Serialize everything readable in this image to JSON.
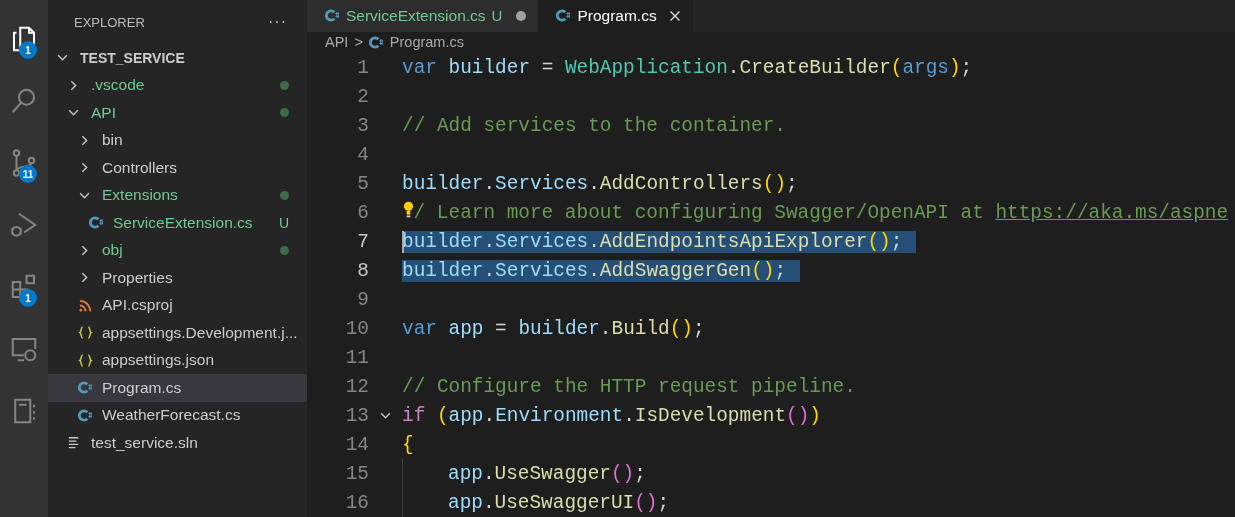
{
  "activity_bar": [
    {
      "kind": "files",
      "selected": true,
      "badge": "1"
    },
    {
      "kind": "search",
      "selected": false
    },
    {
      "kind": "source-control",
      "selected": false,
      "badge": "11"
    },
    {
      "kind": "run-debug",
      "selected": false
    },
    {
      "kind": "extensions",
      "selected": false,
      "badge": "1"
    },
    {
      "kind": "remote",
      "selected": false
    },
    {
      "kind": "notebook",
      "selected": false
    }
  ],
  "explorer": {
    "title": "EXPLORER",
    "more": "···",
    "tree": [
      {
        "label": "TEST_SERVICE",
        "kind": "root",
        "expanded": true,
        "selected": false,
        "children": [
          {
            "label": ".vscode",
            "kind": "folder",
            "expanded": false,
            "selected": false,
            "changed": true
          },
          {
            "label": "API",
            "kind": "folder",
            "expanded": true,
            "selected": false,
            "changed": true,
            "children": [
              {
                "label": "bin",
                "kind": "folder",
                "expanded": false,
                "selected": false
              },
              {
                "label": "Controllers",
                "kind": "folder",
                "expanded": false,
                "selected": false
              },
              {
                "label": "Extensions",
                "kind": "folder",
                "expanded": true,
                "selected": false,
                "changed": true,
                "children": [
                  {
                    "label": "ServiceExtension.cs",
                    "kind": "cs",
                    "selected": false,
                    "changed": true,
                    "decoration": "U"
                  }
                ]
              },
              {
                "label": "obj",
                "kind": "folder",
                "expanded": false,
                "selected": false,
                "changed": true
              },
              {
                "label": "Properties",
                "kind": "folder",
                "expanded": false,
                "selected": false
              },
              {
                "label": "API.csproj",
                "kind": "csproj",
                "selected": false
              },
              {
                "label": "appsettings.Development.j...",
                "kind": "json",
                "selected": false
              },
              {
                "label": "appsettings.json",
                "kind": "json",
                "selected": false
              },
              {
                "label": "Program.cs",
                "kind": "cs",
                "selected": true
              },
              {
                "label": "WeatherForecast.cs",
                "kind": "cs",
                "selected": false
              }
            ]
          },
          {
            "label": "test_service.sln",
            "kind": "sln",
            "selected": false
          }
        ]
      }
    ]
  },
  "tabs": [
    {
      "label": "ServiceExtension.cs",
      "selected": false,
      "changed": true,
      "decoration": "U",
      "dirty": true
    },
    {
      "label": "Program.cs",
      "selected": true,
      "dirty": false
    }
  ],
  "breadcrumb": {
    "folder": "API",
    "separator": ">",
    "file": "Program.cs"
  },
  "lines": [
    {
      "number": "1",
      "selected": false,
      "tokens": [
        {
          "kind": "keyword",
          "text": "var"
        },
        {
          "kind": "variable",
          "text": " builder"
        },
        {
          "kind": "plain",
          "text": " = "
        },
        {
          "kind": "type",
          "text": "WebApplication"
        },
        {
          "kind": "plain",
          "text": "."
        },
        {
          "kind": "method",
          "text": "CreateBuilder"
        },
        {
          "kind": "paren1",
          "text": "("
        },
        {
          "kind": "param",
          "text": "args"
        },
        {
          "kind": "paren1",
          "text": ")"
        },
        {
          "kind": "plain",
          "text": ";"
        }
      ]
    },
    {
      "number": "2",
      "selected": false
    },
    {
      "number": "3",
      "selected": false,
      "tokens": [
        {
          "kind": "comment",
          "text": "// Add services to the container."
        }
      ]
    },
    {
      "number": "4",
      "selected": false
    },
    {
      "number": "5",
      "selected": false,
      "tokens": [
        {
          "kind": "variable",
          "text": "builder"
        },
        {
          "kind": "plain",
          "text": "."
        },
        {
          "kind": "variable",
          "text": "Services"
        },
        {
          "kind": "plain",
          "text": "."
        },
        {
          "kind": "method",
          "text": "AddControllers"
        },
        {
          "kind": "paren1",
          "text": "()"
        },
        {
          "kind": "plain",
          "text": ";"
        }
      ]
    },
    {
      "number": "6",
      "selected": false,
      "lightbulb": true,
      "tokens": [
        {
          "kind": "comment",
          "text": "/ Learn more about configuring Swagger/OpenAPI at "
        },
        {
          "kind": "link",
          "text": "https://aka.ms/aspne"
        }
      ]
    },
    {
      "number": "7",
      "selected": true,
      "cursor": true,
      "tokens": [
        {
          "kind": "variable",
          "text": "builder"
        },
        {
          "kind": "plain",
          "text": "."
        },
        {
          "kind": "variable",
          "text": "Services"
        },
        {
          "kind": "plain",
          "text": "."
        },
        {
          "kind": "method",
          "text": "AddEndpointsApiExplorer"
        },
        {
          "kind": "paren1",
          "text": "()"
        },
        {
          "kind": "plain",
          "text": ";"
        }
      ]
    },
    {
      "number": "8",
      "selected": true,
      "tokens": [
        {
          "kind": "variable",
          "text": "builder"
        },
        {
          "kind": "plain",
          "text": "."
        },
        {
          "kind": "variable",
          "text": "Services"
        },
        {
          "kind": "plain",
          "text": "."
        },
        {
          "kind": "method",
          "text": "AddSwaggerGen"
        },
        {
          "kind": "paren1",
          "text": "()"
        },
        {
          "kind": "plain",
          "text": ";"
        }
      ]
    },
    {
      "number": "9",
      "selected": false
    },
    {
      "number": "10",
      "selected": false,
      "tokens": [
        {
          "kind": "keyword",
          "text": "var"
        },
        {
          "kind": "variable",
          "text": " app"
        },
        {
          "kind": "plain",
          "text": " = "
        },
        {
          "kind": "variable",
          "text": "builder"
        },
        {
          "kind": "plain",
          "text": "."
        },
        {
          "kind": "method",
          "text": "Build"
        },
        {
          "kind": "paren1",
          "text": "()"
        },
        {
          "kind": "plain",
          "text": ";"
        }
      ]
    },
    {
      "number": "11",
      "selected": false
    },
    {
      "number": "12",
      "selected": false,
      "tokens": [
        {
          "kind": "comment",
          "text": "// Configure the HTTP request pipeline."
        }
      ]
    },
    {
      "number": "13",
      "selected": false,
      "fold": true,
      "tokens": [
        {
          "kind": "control",
          "text": "if"
        },
        {
          "kind": "paren1",
          "text": " ("
        },
        {
          "kind": "variable",
          "text": "app"
        },
        {
          "kind": "plain",
          "text": "."
        },
        {
          "kind": "variable",
          "text": "Environment"
        },
        {
          "kind": "plain",
          "text": "."
        },
        {
          "kind": "method",
          "text": "IsDevelopment"
        },
        {
          "kind": "paren2",
          "text": "()"
        },
        {
          "kind": "paren1",
          "text": ")"
        }
      ]
    },
    {
      "number": "14",
      "selected": false,
      "tokens": [
        {
          "kind": "paren1",
          "text": "{"
        }
      ]
    },
    {
      "number": "15",
      "selected": false,
      "indent": true,
      "tokens": [
        {
          "kind": "variable",
          "text": "app"
        },
        {
          "kind": "plain",
          "text": "."
        },
        {
          "kind": "method",
          "text": "UseSwagger"
        },
        {
          "kind": "paren2",
          "text": "()"
        },
        {
          "kind": "plain",
          "text": ";"
        }
      ]
    },
    {
      "number": "16",
      "selected": false,
      "indent": true,
      "tokens": [
        {
          "kind": "variable",
          "text": "app"
        },
        {
          "kind": "plain",
          "text": "."
        },
        {
          "kind": "method",
          "text": "UseSwaggerUI"
        },
        {
          "kind": "paren2",
          "text": "()"
        },
        {
          "kind": "plain",
          "text": ";"
        }
      ]
    }
  ]
}
